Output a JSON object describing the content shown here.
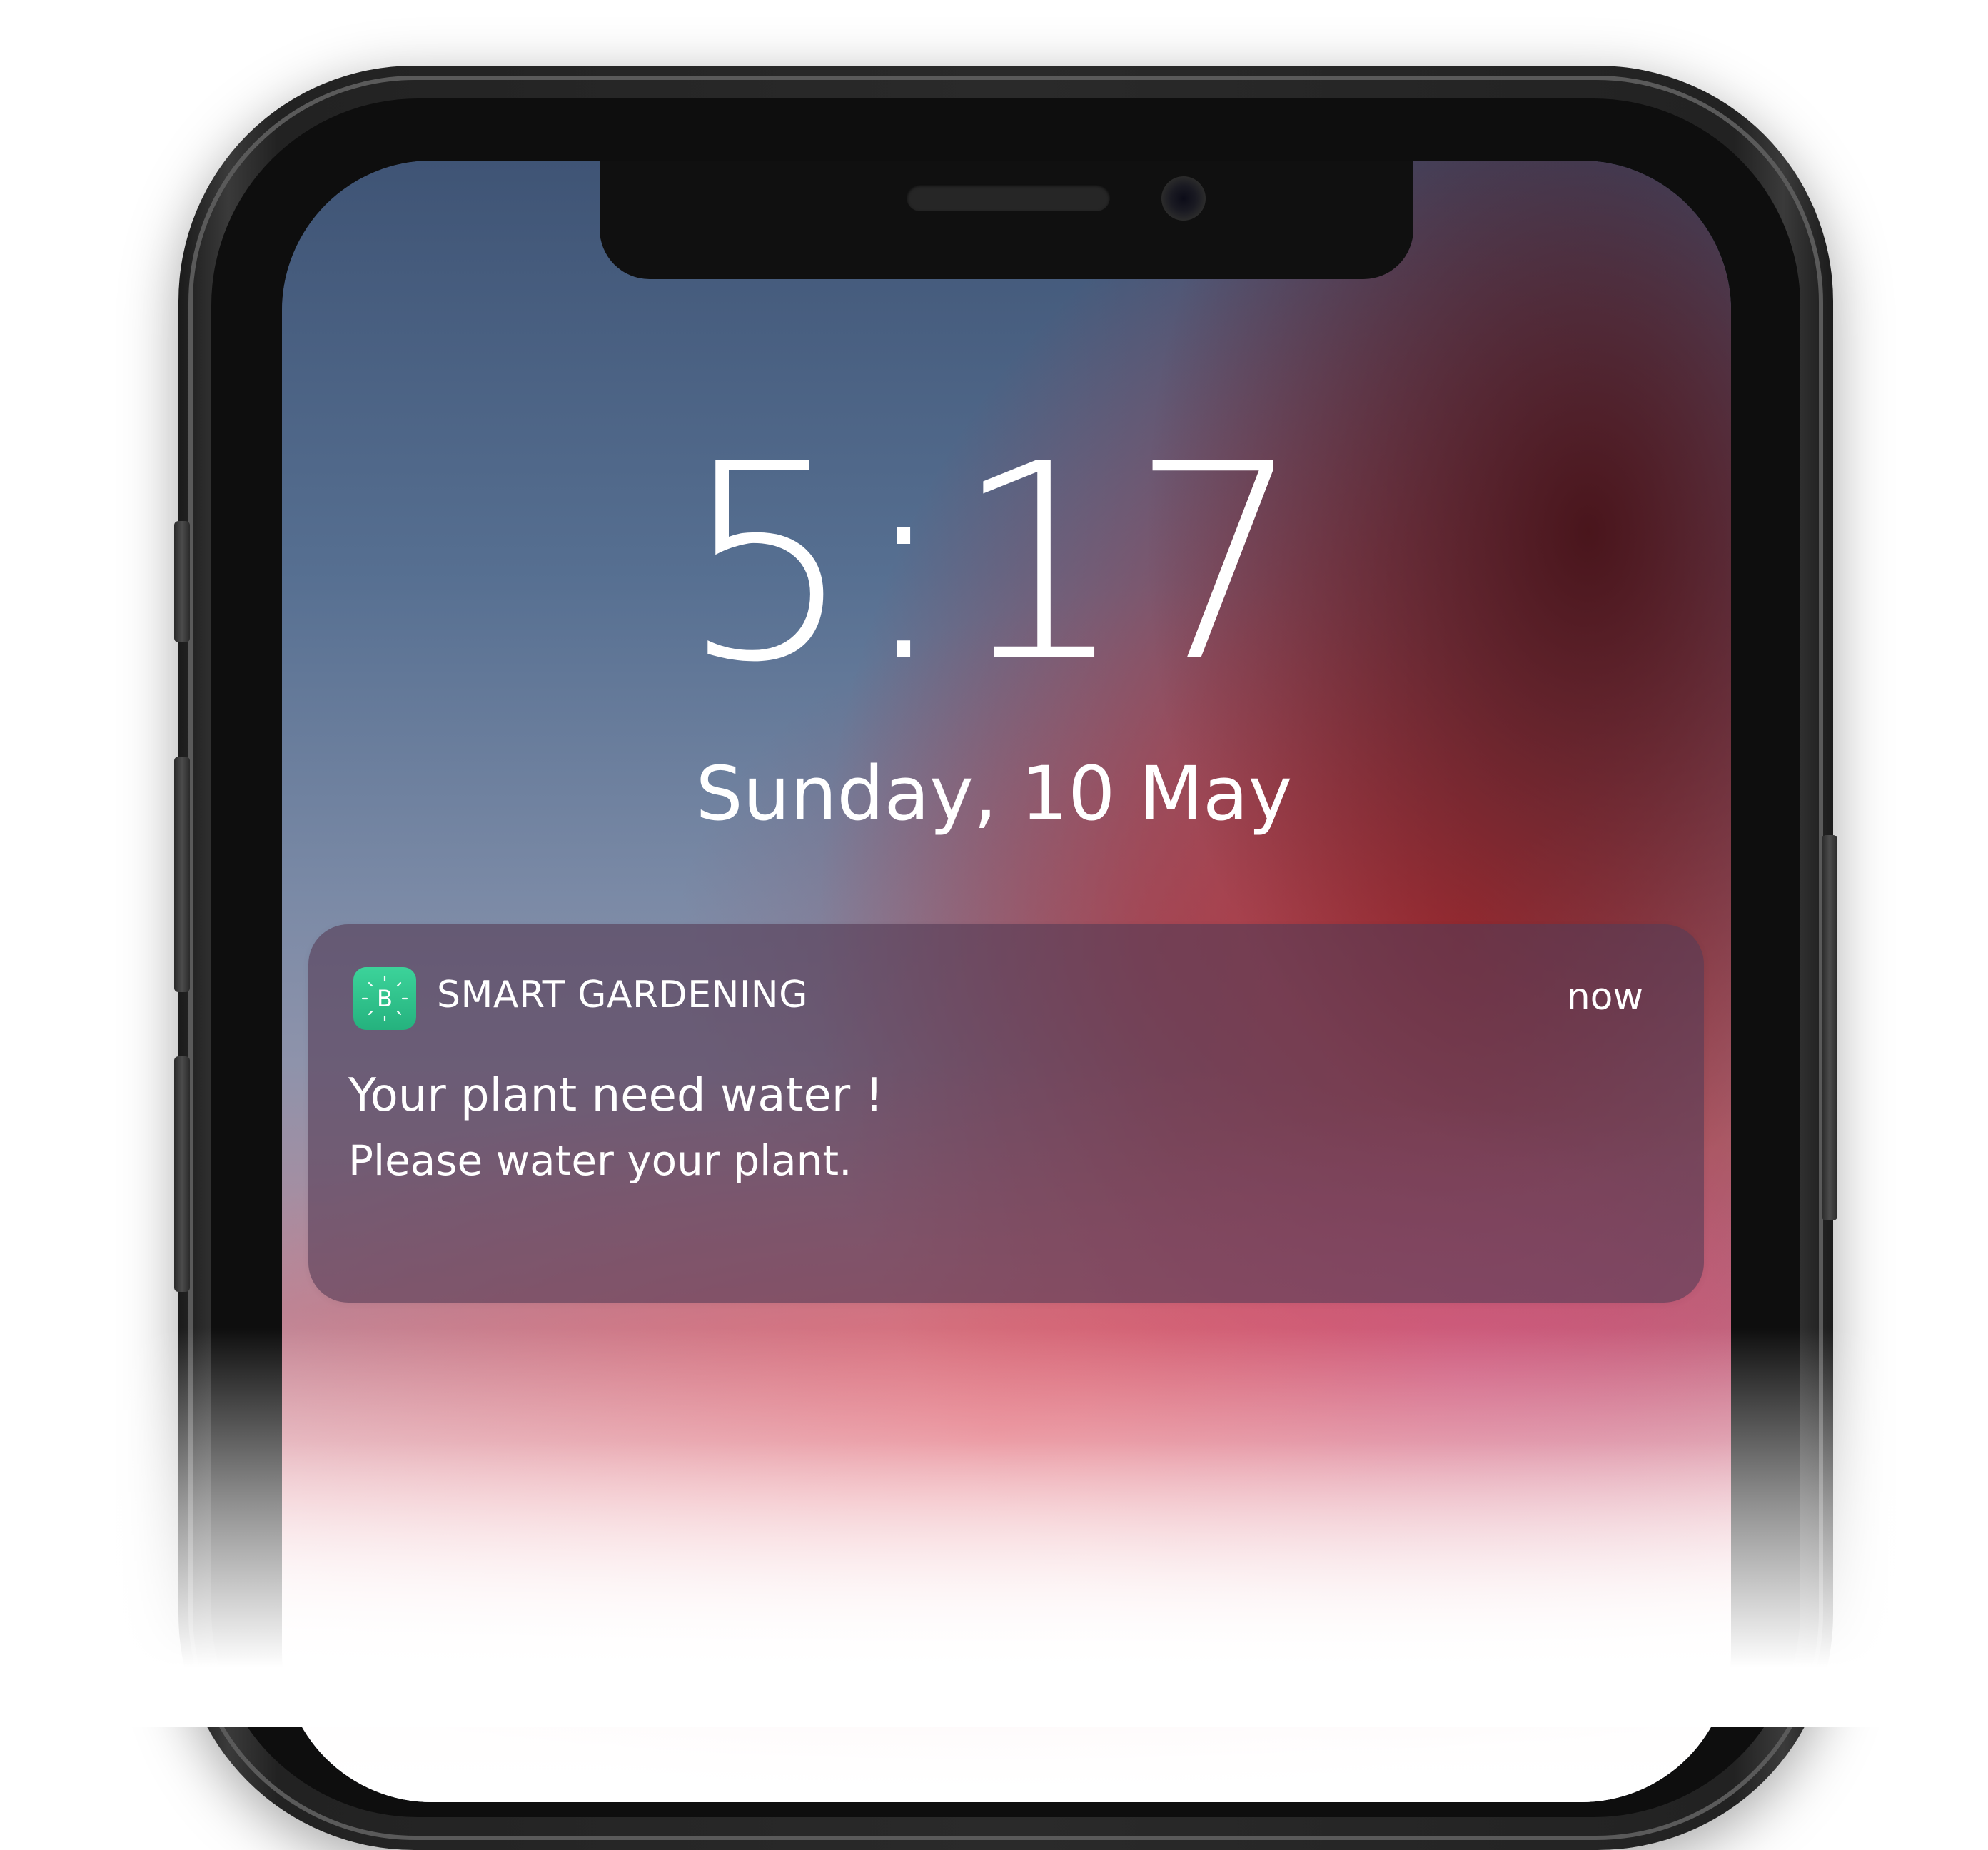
{
  "lock_screen": {
    "time": "5:17",
    "date": "Sunday, 10 May"
  },
  "notification": {
    "app_icon": "blynk-b-icon",
    "app_name": "SMART GARDENING",
    "time": "now",
    "title": "Your plant need water !",
    "body": "Please water your plant.",
    "accent_color": "#2ec48a"
  },
  "device": {
    "icons": [
      "speaker-grille",
      "front-camera"
    ]
  }
}
